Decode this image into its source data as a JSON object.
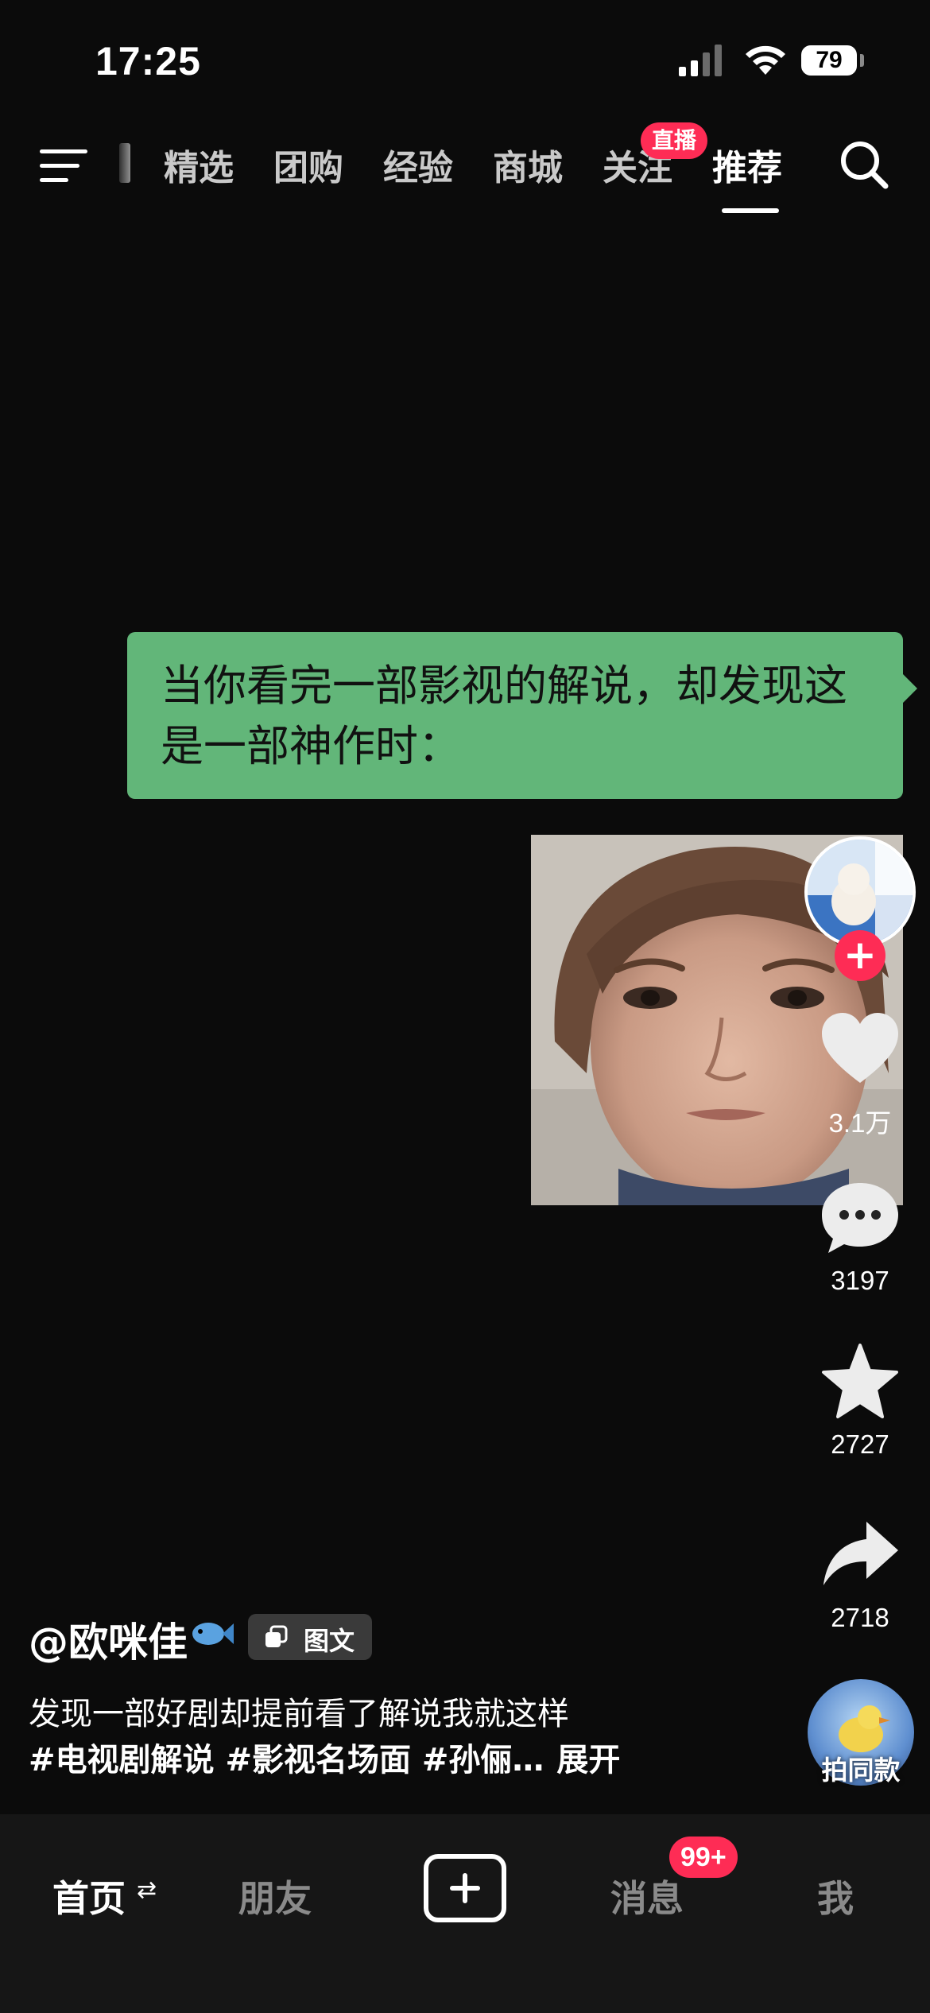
{
  "status_bar": {
    "time": "17:25",
    "battery": "79",
    "signal_icon": "signal-bars-icon",
    "wifi_icon": "wifi-icon"
  },
  "top_nav": {
    "menu_icon": "menu-icon",
    "tabs": [
      "精选",
      "团购",
      "经验",
      "商城",
      "关注",
      "推荐"
    ],
    "active_tab": "推荐",
    "live_badge": "直播",
    "search_icon": "search-icon"
  },
  "post": {
    "bubble_text": "当你看完一部影视的解说，却发现这是一部神作时：",
    "author": "@欧咪佳",
    "post_type": "图文",
    "description": "发现一部好剧却提前看了解说我就这样",
    "tags": "#电视剧解说 #影视名场面 #孙俪…",
    "expand_label": "展开"
  },
  "actions": {
    "likes": "3.1万",
    "comments": "3197",
    "favorites": "2727",
    "shares": "2718",
    "remix_label": "拍同款",
    "follow_symbol": "+"
  },
  "tab_bar": {
    "home": "首页",
    "friends": "朋友",
    "messages": "消息",
    "messages_badge": "99+",
    "me": "我",
    "refresh_glyph": "⇄"
  },
  "colors": {
    "accent_red": "#fe2c55",
    "bubble_green": "#62b679",
    "background": "#0b0b0b",
    "tabbar_bg": "#161616"
  }
}
